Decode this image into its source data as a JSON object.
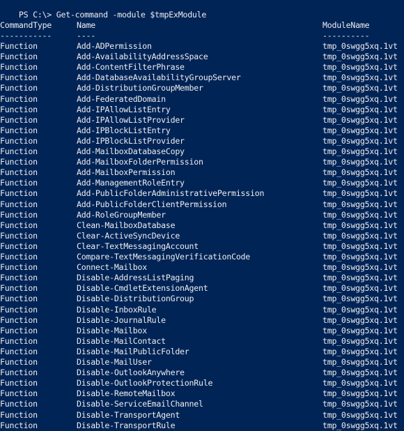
{
  "console": {
    "prompt": "PS C:\\> ",
    "command": "Get-command -module $tmpExModule",
    "background_color": "#012456",
    "text_color": "#eeedf0"
  },
  "table": {
    "headers": [
      "CommandType",
      "Name",
      "ModuleName"
    ],
    "separators": [
      "-----------",
      "----",
      "----------"
    ],
    "rows": [
      [
        "Function",
        "Add-ADPermission",
        "tmp_0swgg5xq.1vt"
      ],
      [
        "Function",
        "Add-AvailabilityAddressSpace",
        "tmp_0swgg5xq.1vt"
      ],
      [
        "Function",
        "Add-ContentFilterPhrase",
        "tmp_0swgg5xq.1vt"
      ],
      [
        "Function",
        "Add-DatabaseAvailabilityGroupServer",
        "tmp_0swgg5xq.1vt"
      ],
      [
        "Function",
        "Add-DistributionGroupMember",
        "tmp_0swgg5xq.1vt"
      ],
      [
        "Function",
        "Add-FederatedDomain",
        "tmp_0swgg5xq.1vt"
      ],
      [
        "Function",
        "Add-IPAllowListEntry",
        "tmp_0swgg5xq.1vt"
      ],
      [
        "Function",
        "Add-IPAllowListProvider",
        "tmp_0swgg5xq.1vt"
      ],
      [
        "Function",
        "Add-IPBlockListEntry",
        "tmp_0swgg5xq.1vt"
      ],
      [
        "Function",
        "Add-IPBlockListProvider",
        "tmp_0swgg5xq.1vt"
      ],
      [
        "Function",
        "Add-MailboxDatabaseCopy",
        "tmp_0swgg5xq.1vt"
      ],
      [
        "Function",
        "Add-MailboxFolderPermission",
        "tmp_0swgg5xq.1vt"
      ],
      [
        "Function",
        "Add-MailboxPermission",
        "tmp_0swgg5xq.1vt"
      ],
      [
        "Function",
        "Add-ManagementRoleEntry",
        "tmp_0swgg5xq.1vt"
      ],
      [
        "Function",
        "Add-PublicFolderAdministrativePermission",
        "tmp_0swgg5xq.1vt"
      ],
      [
        "Function",
        "Add-PublicFolderClientPermission",
        "tmp_0swgg5xq.1vt"
      ],
      [
        "Function",
        "Add-RoleGroupMember",
        "tmp_0swgg5xq.1vt"
      ],
      [
        "Function",
        "Clean-MailboxDatabase",
        "tmp_0swgg5xq.1vt"
      ],
      [
        "Function",
        "Clear-ActiveSyncDevice",
        "tmp_0swgg5xq.1vt"
      ],
      [
        "Function",
        "Clear-TextMessagingAccount",
        "tmp_0swgg5xq.1vt"
      ],
      [
        "Function",
        "Compare-TextMessagingVerificationCode",
        "tmp_0swgg5xq.1vt"
      ],
      [
        "Function",
        "Connect-Mailbox",
        "tmp_0swgg5xq.1vt"
      ],
      [
        "Function",
        "Disable-AddressListPaging",
        "tmp_0swgg5xq.1vt"
      ],
      [
        "Function",
        "Disable-CmdletExtensionAgent",
        "tmp_0swgg5xq.1vt"
      ],
      [
        "Function",
        "Disable-DistributionGroup",
        "tmp_0swgg5xq.1vt"
      ],
      [
        "Function",
        "Disable-InboxRule",
        "tmp_0swgg5xq.1vt"
      ],
      [
        "Function",
        "Disable-JournalRule",
        "tmp_0swgg5xq.1vt"
      ],
      [
        "Function",
        "Disable-Mailbox",
        "tmp_0swgg5xq.1vt"
      ],
      [
        "Function",
        "Disable-MailContact",
        "tmp_0swgg5xq.1vt"
      ],
      [
        "Function",
        "Disable-MailPublicFolder",
        "tmp_0swgg5xq.1vt"
      ],
      [
        "Function",
        "Disable-MailUser",
        "tmp_0swgg5xq.1vt"
      ],
      [
        "Function",
        "Disable-OutlookAnywhere",
        "tmp_0swgg5xq.1vt"
      ],
      [
        "Function",
        "Disable-OutlookProtectionRule",
        "tmp_0swgg5xq.1vt"
      ],
      [
        "Function",
        "Disable-RemoteMailbox",
        "tmp_0swgg5xq.1vt"
      ],
      [
        "Function",
        "Disable-ServiceEmailChannel",
        "tmp_0swgg5xq.1vt"
      ],
      [
        "Function",
        "Disable-TransportAgent",
        "tmp_0swgg5xq.1vt"
      ],
      [
        "Function",
        "Disable-TransportRule",
        "tmp_0swgg5xq.1vt"
      ]
    ]
  }
}
